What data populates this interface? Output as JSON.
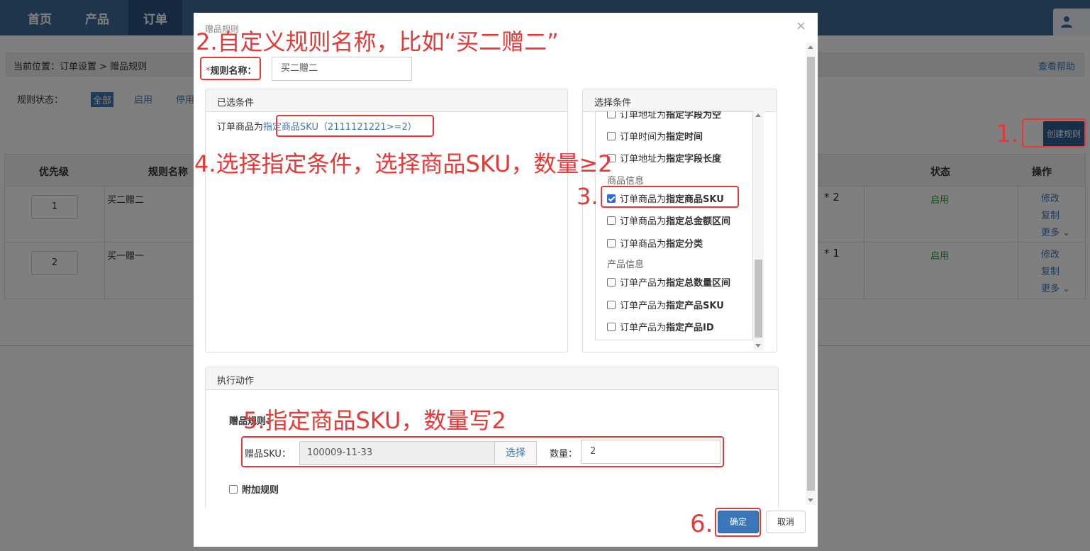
{
  "nav": {
    "items": [
      {
        "label": "首页"
      },
      {
        "label": "产品"
      },
      {
        "label": "订单"
      }
    ]
  },
  "page": {
    "breadcrumb": "当前位置：订单设置 > 赠品规则",
    "help": "查看帮助",
    "status_label": "规则状态：",
    "status_all": "全部",
    "status_enabled": "启用",
    "status_disabled": "停用",
    "create_button": "创建规则",
    "table": {
      "headers": [
        "优先级",
        "规则名称",
        "状态",
        "操作"
      ],
      "rows": [
        {
          "priority": "1",
          "name": "买二赠二",
          "qty_suffix": "* 2",
          "status": "启用",
          "ops": [
            "修改",
            "复制",
            "更多 ⌄"
          ]
        },
        {
          "priority": "2",
          "name": "买一赠一",
          "qty_suffix": "* 1",
          "status": "启用",
          "ops": [
            "修改",
            "复制",
            "更多 ⌄"
          ]
        }
      ]
    }
  },
  "modal": {
    "title": "赠品规则",
    "rule_name_label": "规则名称：",
    "rule_name_value": "买二赠二",
    "selected_panel_title": "已选条件",
    "selected_condition_prefix": "订单商品为",
    "selected_condition_link": "指定商品SKU（2111121221>=2）",
    "choose_panel_title": "选择条件",
    "conditions": [
      {
        "text_a": "订单地址为",
        "text_b": "指定字段为空",
        "checked": false
      },
      {
        "text_a": "订单时间为",
        "text_b": "指定时间",
        "checked": false
      },
      {
        "text_a": "订单地址为",
        "text_b": "指定字段长度",
        "checked": false
      },
      {
        "group": "商品信息"
      },
      {
        "text_a": "订单商品为",
        "text_b": "指定商品SKU",
        "checked": true
      },
      {
        "text_a": "订单商品为",
        "text_b": "指定总金额区间",
        "checked": false
      },
      {
        "text_a": "订单商品为",
        "text_b": "指定分类",
        "checked": false
      },
      {
        "group": "产品信息"
      },
      {
        "text_a": "订单产品为",
        "text_b": "指定总数量区间",
        "checked": false
      },
      {
        "text_a": "订单产品为",
        "text_b": "指定产品SKU",
        "checked": false
      },
      {
        "text_a": "订单产品为",
        "text_b": "指定产品ID",
        "checked": false
      }
    ],
    "action_panel_title": "执行动作",
    "gift_rule_label": "赠品规则：",
    "sku_label": "赠品SKU：",
    "sku_value": "100009-11-33",
    "select_button": "选择",
    "qty_label": "数量：",
    "qty_value": "2",
    "extra_rule_label": "附加规则",
    "ok_button": "确定",
    "cancel_button": "取消"
  },
  "annotations": {
    "step1": "1.",
    "step2": "2.自定义规则名称，比如“买二赠二”",
    "step3": "3.",
    "step4": "4.选择指定条件，选择商品SKU，数量≥2",
    "step5": "5.指定商品SKU，数量写2",
    "step6": "6."
  },
  "colors": {
    "nav_bg": "#3c6b98",
    "accent": "#3a77b9",
    "annotation_red": "#e53935",
    "enabled_green": "#2a9a2a"
  }
}
